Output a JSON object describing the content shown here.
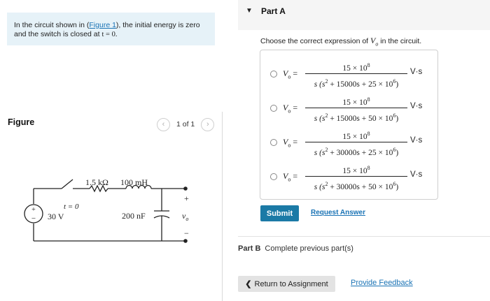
{
  "intro": {
    "text_before": "In the circuit shown in (",
    "figure_link": "Figure 1",
    "text_after": "), the initial energy is zero and the switch is closed at ",
    "math": "t = 0."
  },
  "figure": {
    "label": "Figure",
    "pager": {
      "prev": "‹",
      "count": "1 of 1",
      "next": "›"
    }
  },
  "circuit": {
    "resistor": "1.5 kΩ",
    "inductor": "100 mH",
    "capacitor": "200 nF",
    "source": "30 V",
    "source_plus": "+",
    "source_minus": "−",
    "switch": "t = 0",
    "out_plus": "+",
    "out_minus": "−",
    "output": "v",
    "output_sub": "o"
  },
  "partA": {
    "title": "Part A",
    "question": "Choose the correct expression of",
    "question_var": "V",
    "question_sub": "o",
    "question_end": " in the circuit.",
    "options": [
      {
        "lhs": "V",
        "sub": "o",
        "num": "15 × 10",
        "num_exp": "8",
        "den_a": "s (s",
        "den_b": "2",
        "den_c": " + 15000s + 25 × 10",
        "den_d": "6",
        "den_e": ")",
        "unit": "V·s"
      },
      {
        "lhs": "V",
        "sub": "o",
        "num": "15 × 10",
        "num_exp": "8",
        "den_a": "s (s",
        "den_b": "2",
        "den_c": " + 15000s + 50 × 10",
        "den_d": "6",
        "den_e": ")",
        "unit": "V·s"
      },
      {
        "lhs": "V",
        "sub": "o",
        "num": "15 × 10",
        "num_exp": "8",
        "den_a": "s (s",
        "den_b": "2",
        "den_c": " + 30000s + 25 × 10",
        "den_d": "6",
        "den_e": ")",
        "unit": "V·s"
      },
      {
        "lhs": "V",
        "sub": "o",
        "num": "15 × 10",
        "num_exp": "8",
        "den_a": "s (s",
        "den_b": "2",
        "den_c": " + 30000s + 50 × 10",
        "den_d": "6",
        "den_e": ")",
        "unit": "V·s"
      }
    ],
    "submit": "Submit",
    "request_answer": "Request Answer"
  },
  "partB": {
    "label": "Part B",
    "text": "Complete previous part(s)"
  },
  "footer": {
    "return": "Return to Assignment",
    "return_icon": "chevron-left-icon",
    "feedback": "Provide Feedback"
  },
  "colors": {
    "accent": "#1b7aa6",
    "link": "#1a73b5",
    "intro_bg": "#e6f2f8"
  }
}
